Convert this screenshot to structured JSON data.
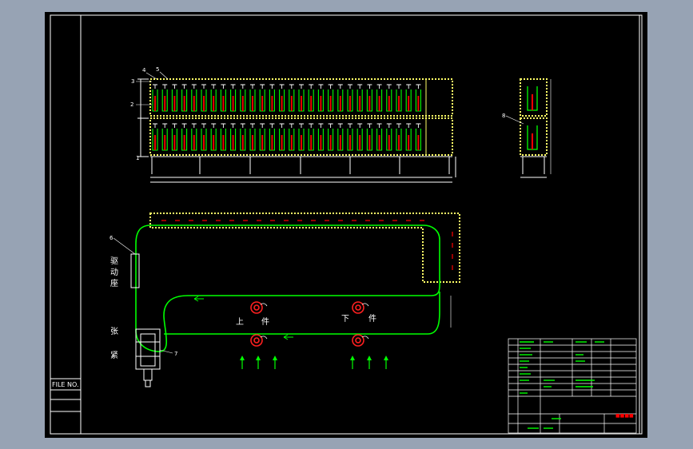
{
  "colors": {
    "background": "#97a3b4",
    "sheet": "#000000",
    "frame": "#ffffff",
    "conveyor": "#00ff00",
    "rack": "#ffff66",
    "highlight": "#ff0000",
    "callout": "#ffffff"
  },
  "callouts": {
    "n1": "1",
    "n2": "2",
    "n3": "3",
    "n4": "4",
    "n5": "5",
    "n6": "6",
    "n7": "7",
    "n8": "8"
  },
  "labels": {
    "drive_1": "驱",
    "drive_2": "动",
    "drive_3": "座",
    "tension_1": "张",
    "tension_2": "紧",
    "load_1": "上",
    "load_2": "件",
    "unload_1": "下",
    "unload_2": "件"
  },
  "file_no_label": "FILE NO.",
  "title_block": {
    "red_stamp": "■■■■"
  },
  "icons": {
    "load_station": "robot-gripper-icon",
    "unload_station": "robot-gripper-icon",
    "direction": "arrow-up-icon"
  }
}
